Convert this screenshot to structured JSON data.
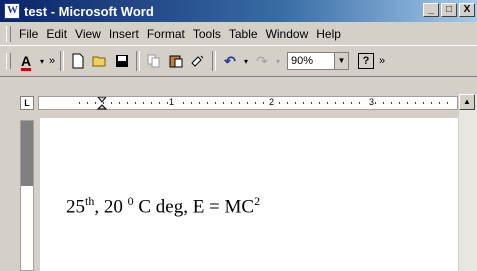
{
  "window": {
    "title": "test - Microsoft Word",
    "minimize": "_",
    "maximize": "□",
    "close": "X"
  },
  "menu": [
    {
      "label": "File"
    },
    {
      "label": "Edit"
    },
    {
      "label": "View"
    },
    {
      "label": "Insert"
    },
    {
      "label": "Format"
    },
    {
      "label": "Tools"
    },
    {
      "label": "Table"
    },
    {
      "label": "Window"
    },
    {
      "label": "Help"
    }
  ],
  "toolbar": {
    "font_color_glyph": "A",
    "more": "»",
    "undo": "↶",
    "redo": "↷",
    "zoom": "90%",
    "help": "?",
    "more_right": "»"
  },
  "ruler": {
    "tab_selector": "L",
    "numbers": [
      "1",
      "2",
      "3"
    ]
  },
  "document": {
    "num1": "25",
    "sup1": "th",
    "mid": ", 20 ",
    "sup2": "0",
    "mid2": " C deg, E = MC",
    "sup3": "2"
  },
  "icons": [
    "word-app-icon",
    "new-document-icon",
    "open-folder-icon",
    "save-icon",
    "copy-icon",
    "paste-icon",
    "format-painter-icon",
    "undo-icon",
    "redo-icon",
    "help-icon"
  ]
}
